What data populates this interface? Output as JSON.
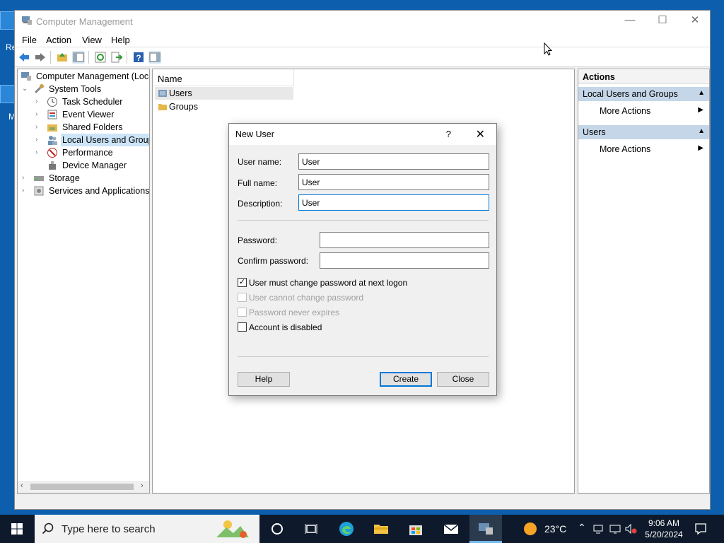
{
  "desktop": {
    "icon_labels": [
      "Re",
      "M"
    ]
  },
  "window": {
    "title": "Computer Management",
    "minimize": "—",
    "maximize": "☐",
    "close": "✕"
  },
  "menu": [
    "File",
    "Action",
    "View",
    "Help"
  ],
  "tree": {
    "root": "Computer Management (Local",
    "system_tools": "System Tools",
    "items": [
      "Task Scheduler",
      "Event Viewer",
      "Shared Folders",
      "Local Users and Groups",
      "Performance",
      "Device Manager"
    ],
    "storage": "Storage",
    "services": "Services and Applications"
  },
  "list": {
    "header": "Name",
    "rows": [
      "Users",
      "Groups"
    ]
  },
  "actions": {
    "title": "Actions",
    "section1": "Local Users and Groups",
    "more1": "More Actions",
    "section2": "Users",
    "more2": "More Actions"
  },
  "dialog": {
    "title": "New User",
    "help_glyph": "?",
    "close_glyph": "✕",
    "username_label": "User name:",
    "username_value": "User",
    "fullname_label": "Full name:",
    "fullname_value": "User",
    "description_label": "Description:",
    "description_value": "User",
    "password_label": "Password:",
    "password_value": "",
    "confirm_label": "Confirm password:",
    "confirm_value": "",
    "chk_must_change": "User must change password at next logon",
    "chk_cannot_change": "User cannot change password",
    "chk_never_expires": "Password never expires",
    "chk_disabled": "Account is disabled",
    "checkmark": "✓",
    "help_button": "Help",
    "create_button": "Create",
    "close_button": "Close"
  },
  "taskbar": {
    "search_placeholder": "Type here to search",
    "temperature": "23°C",
    "time": "9:06 AM",
    "date": "5/20/2024"
  },
  "colors": {
    "accent": "#0078d7",
    "selection": "#cce4f7",
    "section": "#c5d6e8",
    "taskbar": "#0e1a2b"
  }
}
